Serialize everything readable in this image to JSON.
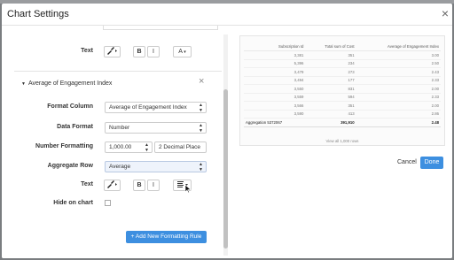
{
  "modal": {
    "title": "Chart Settings",
    "close_icon": "close-icon"
  },
  "formatting": {
    "top_text_label": "Text",
    "bold_label": "B",
    "italic_label": "I",
    "font_size_label": "A",
    "section_title": "Average of Engagement Index",
    "format_column_label": "Format Column",
    "format_column_value": "Average of Engagement Index",
    "data_format_label": "Data Format",
    "data_format_value": "Number",
    "number_formatting_label": "Number Formatting",
    "number_format_value": "1,000.00",
    "decimal_value": "2 Decimal Place",
    "aggregate_row_label": "Aggregate Row",
    "aggregate_row_value": "Average",
    "text_label": "Text",
    "hide_on_chart_label": "Hide on chart",
    "add_rule_label": "+ Add New Formatting Rule"
  },
  "preview": {
    "columns": [
      "Subscription Id",
      "Total sum of Cost",
      "Average of Engagement Index"
    ],
    "rows": [
      [
        "3,381",
        "351",
        "3.00"
      ],
      [
        "5,396",
        "234",
        "2.50"
      ],
      [
        "3,479",
        "273",
        "2.43"
      ],
      [
        "3,494",
        "177",
        "2.33"
      ],
      [
        "3,550",
        "831",
        "2.00"
      ],
      [
        "3,559",
        "594",
        "2.33"
      ],
      [
        "3,566",
        "351",
        "2.00"
      ],
      [
        "3,590",
        "413",
        "2.86"
      ]
    ],
    "aggregate": [
      "Aggregation 5372067",
      "391,910",
      "2.48"
    ],
    "view_all": "View all 1,000 rows"
  },
  "footer": {
    "cancel_label": "Cancel",
    "done_label": "Done"
  },
  "colors": {
    "primary_button": "#3d8fe0",
    "highlight_select": "#eef3fb"
  }
}
